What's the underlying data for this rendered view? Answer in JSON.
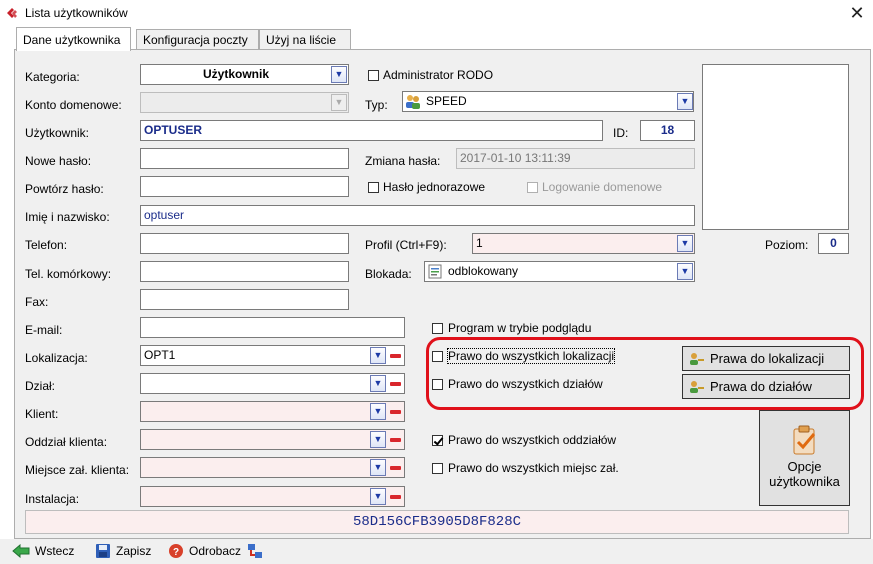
{
  "window": {
    "title": "Lista użytkowników",
    "close": "✕"
  },
  "tabs": [
    {
      "label": "Dane użytkownika",
      "active": true
    },
    {
      "label": "Konfiguracja poczty",
      "active": false
    },
    {
      "label": "Użyj na liście",
      "active": false
    }
  ],
  "labels": {
    "kategoria": "Kategoria:",
    "konto_domenowe": "Konto domenowe:",
    "uzytkownik": "Użytkownik:",
    "nowe_haslo": "Nowe hasło:",
    "powtorz_haslo": "Powtórz hasło:",
    "imie_nazwisko": "Imię i nazwisko:",
    "telefon": "Telefon:",
    "tel_kom": "Tel. komórkowy:",
    "fax": "Fax:",
    "email": "E-mail:",
    "lokalizacja": "Lokalizacja:",
    "dzial": "Dział:",
    "klient": "Klient:",
    "oddzial_klienta": "Oddział klienta:",
    "miejsce_zal": "Miejsce zał. klienta:",
    "instalacja": "Instalacja:",
    "typ": "Typ:",
    "id": "ID:",
    "zmiana_hasla": "Zmiana hasła:",
    "profil": "Profil  (Ctrl+F9):",
    "blokada": "Blokada:",
    "poziom": "Poziom:"
  },
  "values": {
    "kategoria": "Użytkownik",
    "uzytkownik": "OPTUSER",
    "id": "18",
    "zmiana_hasla": "2017-01-10 13:11:39",
    "imie_nazwisko": "optuser",
    "typ": "SPEED",
    "profil": "1",
    "blokada": "odblokowany",
    "lokalizacja": "OPT1",
    "poziom": "0",
    "hash": "58D156CFB3905D8F828C"
  },
  "checkboxes": {
    "admin_rodo": {
      "label": "Administrator RODO",
      "checked": false
    },
    "haslo_jednorazowe": {
      "label": "Hasło jednorazowe",
      "checked": false
    },
    "logowanie_domenowe": {
      "label": "Logowanie domenowe",
      "checked": false
    },
    "tryb_podgladu": {
      "label": "Program w trybie podglądu",
      "checked": false
    },
    "wszystkie_lokalizacje": {
      "label": "Prawo do wszystkich lokalizacji",
      "checked": false
    },
    "wszystkie_dzialy": {
      "label": "Prawo do wszystkich działów",
      "checked": false
    },
    "wszystkie_oddzialy": {
      "label": "Prawo do wszystkich oddziałów",
      "checked": true
    },
    "wszystkie_miejsca": {
      "label": "Prawo do wszystkich miejsc zał.",
      "checked": false
    }
  },
  "buttons": {
    "prawa_lokalizacji": "Prawa do lokalizacji",
    "prawa_dzialow": "Prawa do działów",
    "opcje_line1": "Opcje",
    "opcje_line2": "użytkownika"
  },
  "bottom": {
    "wstecz": "Wstecz",
    "zapisz": "Zapisz",
    "odrobacz": "Odrobacz"
  },
  "colors": {
    "highlight": "#e0101a",
    "value_blue": "#1a2c8a"
  }
}
